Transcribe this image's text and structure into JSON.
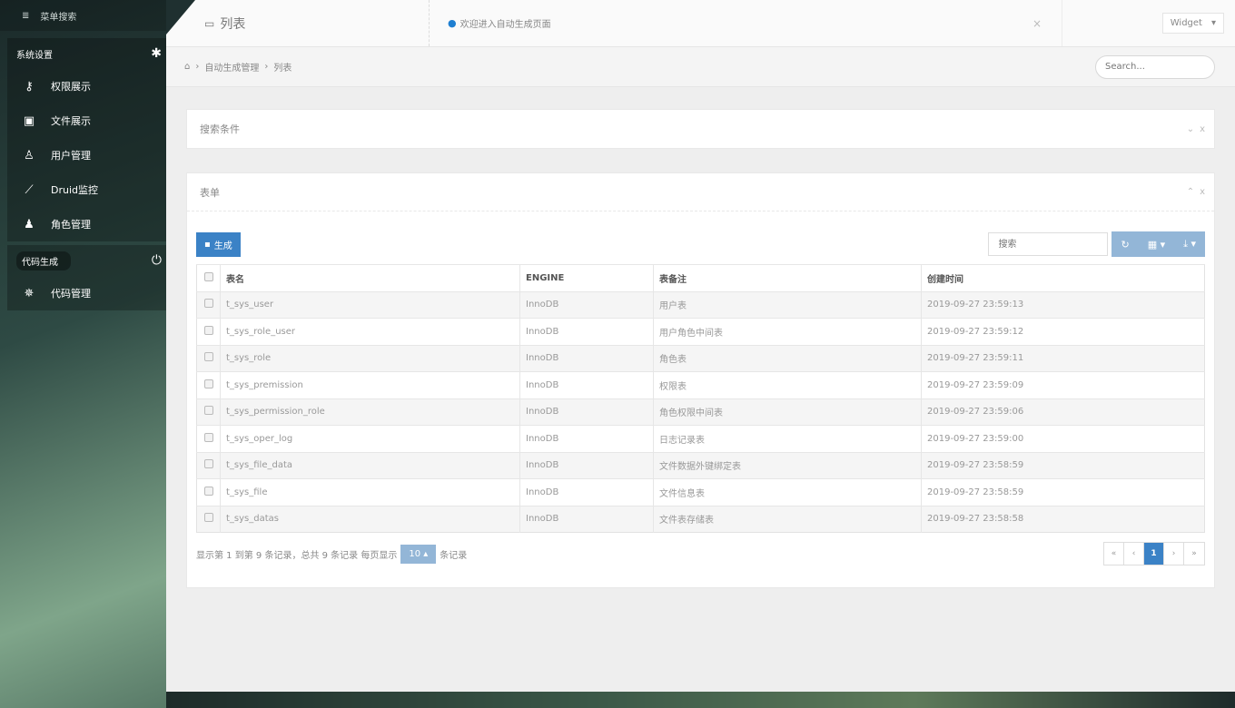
{
  "sidebar": {
    "search_label": "菜单搜索",
    "group1": {
      "title": "系统设置",
      "items": [
        {
          "label": "权限展示"
        },
        {
          "label": "文件展示"
        },
        {
          "label": "用户管理"
        },
        {
          "label": "Druid监控"
        },
        {
          "label": "角色管理"
        }
      ]
    },
    "group2": {
      "title": "代码生成",
      "items": [
        {
          "label": "代码管理"
        }
      ]
    }
  },
  "topbar": {
    "title": "列表",
    "notice": "欢迎进入自动生成页面",
    "close": "×",
    "widget": "Widget"
  },
  "breadcrumb": {
    "items": [
      "自动生成管理",
      "列表"
    ],
    "search_placeholder": "Search..."
  },
  "search_panel": {
    "title": "搜索条件"
  },
  "form_panel": {
    "title": "表单",
    "generate_button": "生成",
    "table_search_placeholder": "搜索",
    "columns": [
      "表名",
      "ENGINE",
      "表备注",
      "创建时间"
    ],
    "rows": [
      {
        "name": "t_sys_user",
        "engine": "InnoDB",
        "comment": "用户表",
        "created": "2019-09-27 23:59:13"
      },
      {
        "name": "t_sys_role_user",
        "engine": "InnoDB",
        "comment": "用户角色中间表",
        "created": "2019-09-27 23:59:12"
      },
      {
        "name": "t_sys_role",
        "engine": "InnoDB",
        "comment": "角色表",
        "created": "2019-09-27 23:59:11"
      },
      {
        "name": "t_sys_premission",
        "engine": "InnoDB",
        "comment": "权限表",
        "created": "2019-09-27 23:59:09"
      },
      {
        "name": "t_sys_permission_role",
        "engine": "InnoDB",
        "comment": "角色权限中间表",
        "created": "2019-09-27 23:59:06"
      },
      {
        "name": "t_sys_oper_log",
        "engine": "InnoDB",
        "comment": "日志记录表",
        "created": "2019-09-27 23:59:00"
      },
      {
        "name": "t_sys_file_data",
        "engine": "InnoDB",
        "comment": "文件数据外键绑定表",
        "created": "2019-09-27 23:58:59"
      },
      {
        "name": "t_sys_file",
        "engine": "InnoDB",
        "comment": "文件信息表",
        "created": "2019-09-27 23:58:59"
      },
      {
        "name": "t_sys_datas",
        "engine": "InnoDB",
        "comment": "文件表存储表",
        "created": "2019-09-27 23:58:58"
      }
    ],
    "pager_info_prefix": "显示第 1 到第 9 条记录，总共 9 条记录 每页显示",
    "page_size": "10",
    "pager_info_suffix": "条记录",
    "pages": [
      "«",
      "‹",
      "1",
      "›",
      "»"
    ],
    "active_page": "1"
  },
  "colors": {
    "accent": "#3b82c6",
    "muted_button": "#93b6d7"
  }
}
